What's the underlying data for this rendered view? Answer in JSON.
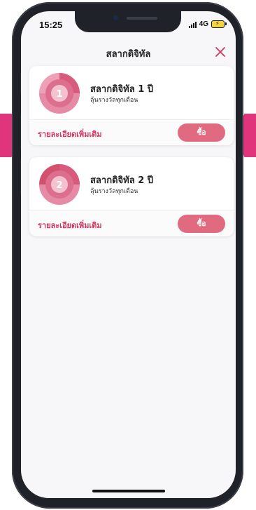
{
  "status_bar": {
    "time": "15:25",
    "network": "4G"
  },
  "header": {
    "title": "สลากดิจิทัล",
    "close_icon": "close-icon"
  },
  "products": [
    {
      "badge_number": "1",
      "title": "สลากดิจิทัล 1 ปี",
      "subtitle": "ลุ้นรางวัลทุกเดือน",
      "details_label": "รายละเอียดเพิ่มเติม",
      "buy_label": "ซื้อ"
    },
    {
      "badge_number": "2",
      "title": "สลากดิจิทัล 2 ปี",
      "subtitle": "ลุ้นรางวัลทุกเดือน",
      "details_label": "รายละเอียดเพิ่มเติม",
      "buy_label": "ซื้อ"
    }
  ],
  "colors": {
    "accent": "#d0395f",
    "button": "#e06a80",
    "side_arrow": "#e0357c"
  }
}
